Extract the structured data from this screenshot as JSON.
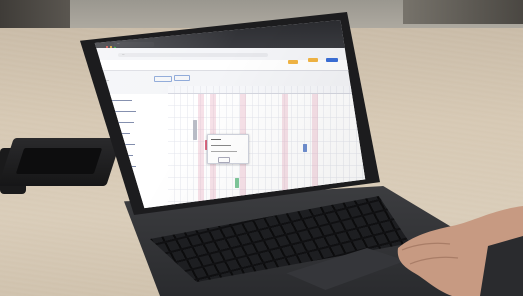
{
  "scene": {
    "description_tag": "laptop-on-desk-showing-scheduler",
    "colors": {
      "accent": "#3b6fd8",
      "pink_highlight": "#e8aabe",
      "green_block": "#7fc79a",
      "orange_badge": "#f2b544"
    }
  },
  "browser": {
    "tab_label": "—",
    "url": "—"
  },
  "app": {
    "title": "—",
    "header_badges": [
      "",
      "",
      ""
    ],
    "toolbar_buttons": [
      "",
      ""
    ]
  },
  "sidebar": {
    "rows": [
      {
        "label": "",
        "sub": ""
      },
      {
        "label": "",
        "sub": ""
      },
      {
        "label": "",
        "sub": ""
      },
      {
        "label": "",
        "sub": ""
      },
      {
        "label": "",
        "sub": ""
      },
      {
        "label": "",
        "sub": ""
      },
      {
        "label": "",
        "sub": ""
      },
      {
        "label": "",
        "sub": ""
      },
      {
        "label": "",
        "sub": ""
      },
      {
        "label": "",
        "sub": ""
      }
    ]
  },
  "popup": {
    "lines": [
      "",
      "",
      ""
    ],
    "button": ""
  }
}
